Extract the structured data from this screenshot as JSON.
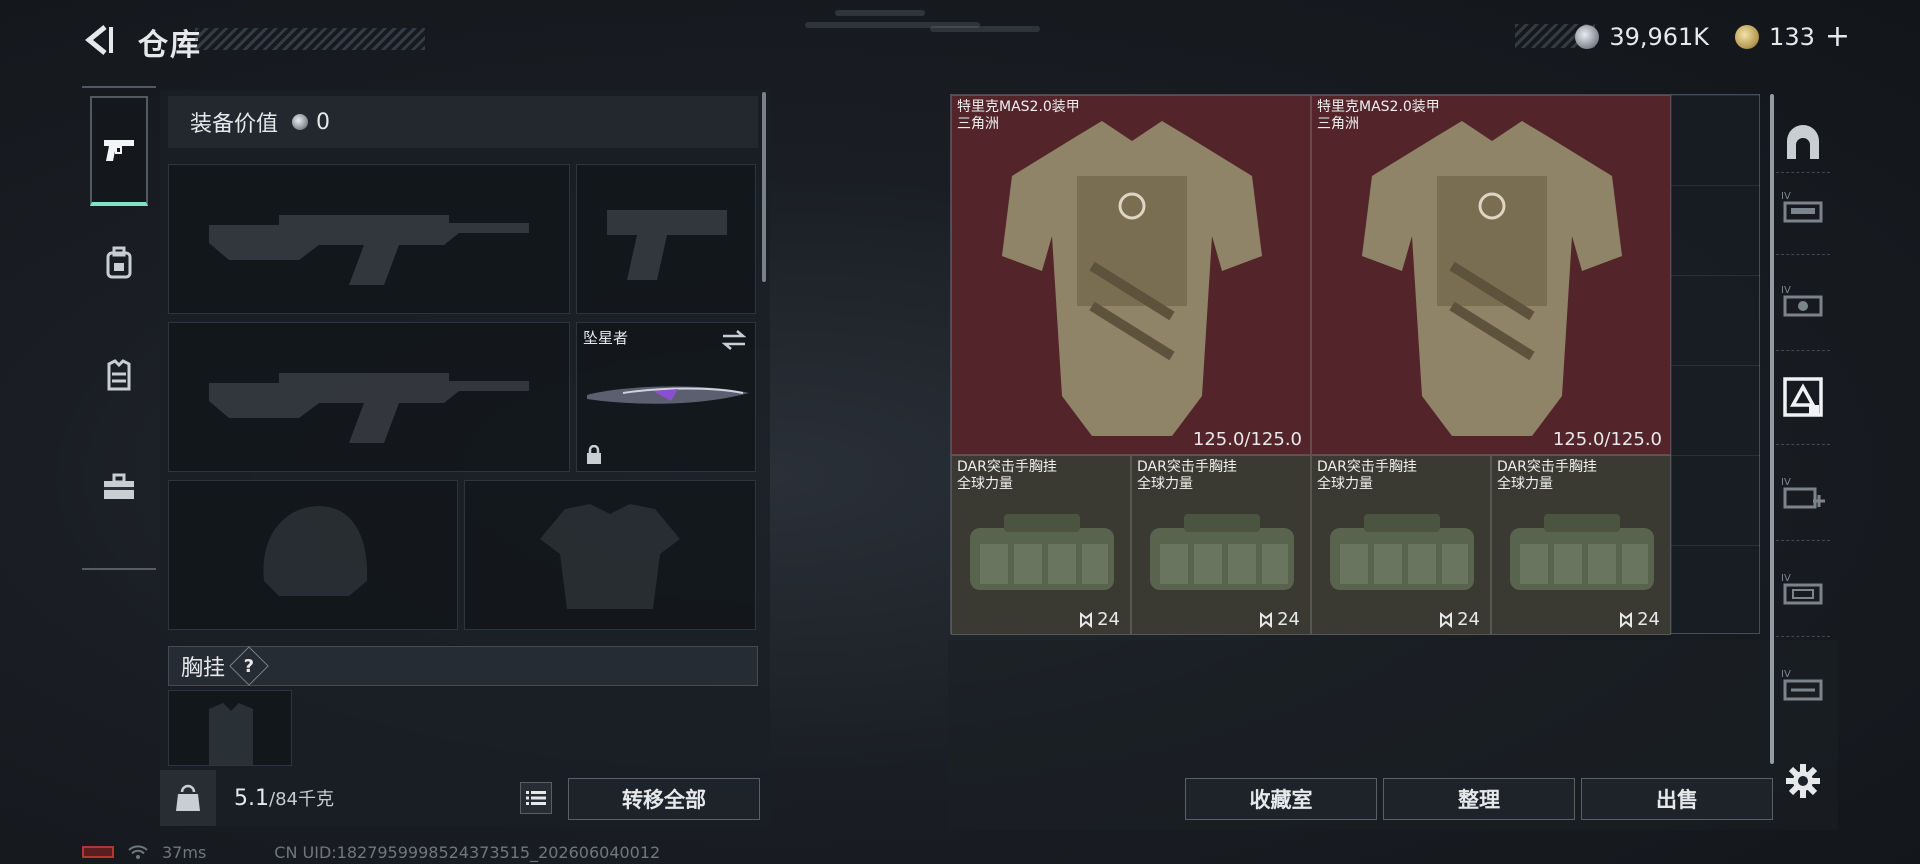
{
  "header": {
    "title": "仓库",
    "currency": {
      "silver": "39,961K",
      "gold": "133"
    },
    "add_symbol": "+"
  },
  "tabs": [
    {
      "icon": "pistol-icon",
      "active": true
    },
    {
      "icon": "backpack-icon",
      "active": false
    },
    {
      "icon": "vest-icon",
      "active": false
    },
    {
      "icon": "toolbox-icon",
      "active": false
    }
  ],
  "loadout": {
    "value_label": "装备价值",
    "value": "0",
    "melee_label": "坠星者",
    "section_label": "胸挂",
    "help_symbol": "?",
    "weight_current": "5.1",
    "weight_max": "/84千克",
    "move_all_label": "转移全部"
  },
  "storage": {
    "items": [
      {
        "type": "armor",
        "name": "特里克MAS2.0装甲\n三角洲",
        "durability": "125.0/125.0"
      },
      {
        "type": "armor",
        "name": "特里克MAS2.0装甲\n三角洲",
        "durability": "125.0/125.0"
      },
      {
        "type": "rig",
        "name": "DAR突击手胸挂\n全球力量",
        "capacity": "24"
      },
      {
        "type": "rig",
        "name": "DAR突击手胸挂\n全球力量",
        "capacity": "24"
      },
      {
        "type": "rig",
        "name": "DAR突击手胸挂\n全球力量",
        "capacity": "24"
      },
      {
        "type": "rig",
        "name": "DAR突击手胸挂\n全球力量",
        "capacity": "24"
      }
    ]
  },
  "actions": {
    "collection": "收藏室",
    "sort": "整理",
    "sell": "出售"
  },
  "status": {
    "ping": "37ms",
    "uid": "CN UID:1827959998524373515_202606040012"
  },
  "colors": {
    "accent": "#7ee2c3",
    "armor_bg": "#53252a",
    "rig_bg": "#3a3a33"
  }
}
